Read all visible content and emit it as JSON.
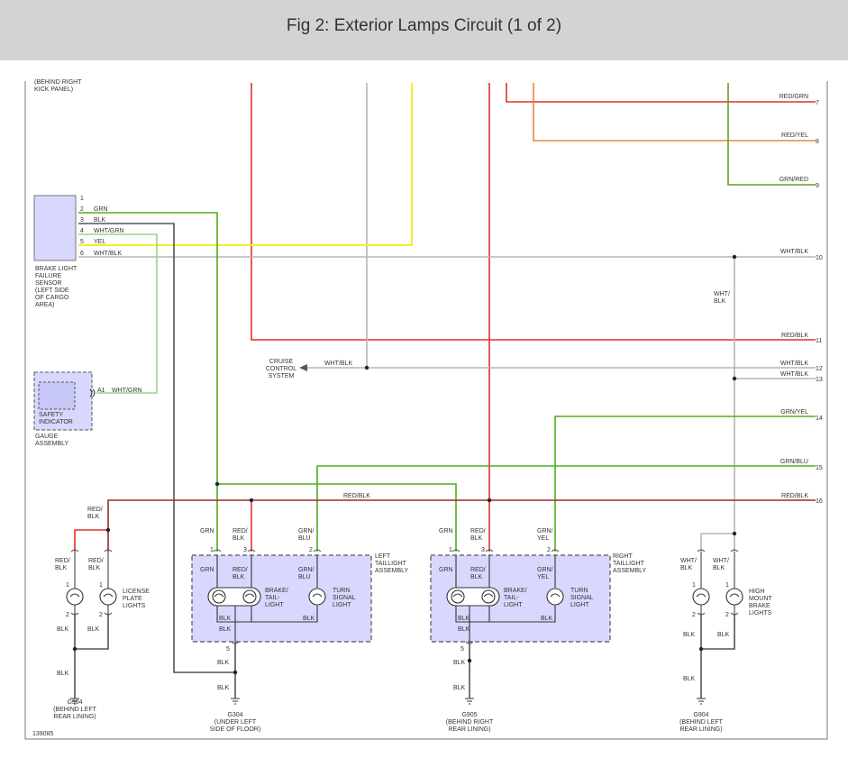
{
  "header": {
    "title": "Fig 2: Exterior Lamps Circuit (1 of 2)"
  },
  "colors": {
    "header_bg": "#d3d3d3",
    "green": "#4caf1e",
    "red": "#e0302a",
    "yellow": "#f2ef29",
    "gray": "#b5b5b5",
    "orange": "#f0843c",
    "olive": "#6b9a2a",
    "light_green": "#9ad48a",
    "dark": "#555555",
    "component_fill": "#d8d8ff",
    "dark_red": "#9e2a2a"
  },
  "labels": {
    "top_kick_panel": "(BEHIND RIGHT\nKICK PANEL)",
    "brake_sensor": "BRAKE LIGHT\nFAILURE\nSENSOR\n(LEFT SIDE\nOF CARGO\nAREA)",
    "gauge": "GAUGE\nASSEMBLY",
    "safety": "SAFETY\nINDICATOR",
    "cruise": "CRUISE\nCONTROL\nSYSTEM",
    "license": "LICENSE\nPLATE\nLIGHTS",
    "left_assy": "LEFT\nTAILLIGHT\nASSEMBLY",
    "right_assy": "RIGHT\nTAILLIGHT\nASSEMBLY",
    "brake_tail": "BRAKE/\nTAIL-\nLIGHT",
    "turn": "TURN\nSIGNAL\nLIGHT",
    "high_mount": "HIGH\nMOUNT\nBRAKE\nLIGHTS",
    "g904_left": "G904\n(BEHIND LEFT\nREAR LINING)",
    "g304": "G304\n(UNDER LEFT\nSIDE OF FLOOR)",
    "g905": "G905\n(BEHIND RIGHT\nREAR LINING)",
    "g904_right": "G904\n(BEHIND LEFT\nREAR LINING)",
    "fig_id": "139085"
  },
  "sensor_pins": [
    {
      "pin": "1",
      "wire": ""
    },
    {
      "pin": "2",
      "wire": "GRN"
    },
    {
      "pin": "3",
      "wire": "BLK"
    },
    {
      "pin": "4",
      "wire": "WHT/GRN"
    },
    {
      "pin": "5",
      "wire": "YEL"
    },
    {
      "pin": "6",
      "wire": "WHT/BLK"
    }
  ],
  "right_wires": [
    {
      "label": "RED/GRN",
      "num": "7"
    },
    {
      "label": "RED/YEL",
      "num": "8"
    },
    {
      "label": "GRN/RED",
      "num": "9"
    },
    {
      "label": "WHT/BLK",
      "num": "10"
    },
    {
      "label": "RED/BLK",
      "num": "11"
    },
    {
      "label": "WHT/BLK",
      "num": "12"
    },
    {
      "label": "WHT/BLK",
      "num": "13"
    },
    {
      "label": "GRN/YEL",
      "num": "14"
    },
    {
      "label": "GRN/BLU",
      "num": "15"
    },
    {
      "label": "RED/BLK",
      "num": "16"
    }
  ],
  "wire_labels": {
    "wht_blk_vertical": "WHT/\nBLK",
    "cruise_wire": "WHT/BLK",
    "gauge_pin": "A1",
    "gauge_wire": "WHT/GRN",
    "red_blk_bus": "RED/BLK",
    "red_blk_stack": "RED/\nBLK",
    "grn": "GRN",
    "grn_blu": "GRN/\nBLU",
    "grn_yel": "GRN/\nYEL",
    "blk": "BLK",
    "wht_blk_stack": "WHT/\nBLK"
  },
  "pin_numbers": {
    "p1": "1",
    "p2": "2",
    "p3": "3",
    "p5": "5"
  }
}
